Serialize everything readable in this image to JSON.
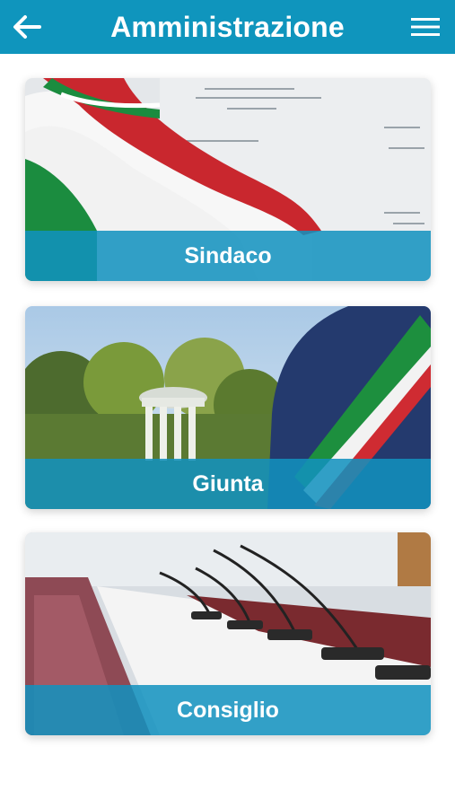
{
  "appbar": {
    "title": "Amministrazione",
    "back_icon": "arrow-left-icon",
    "menu_icon": "hamburger-menu-icon",
    "color": "#0f95bd"
  },
  "cards": [
    {
      "label": "Sindaco",
      "image": "italian-flag-document-image"
    },
    {
      "label": "Giunta",
      "image": "mayor-sash-park-image"
    },
    {
      "label": "Consiglio",
      "image": "council-chamber-microphones-image"
    }
  ],
  "accent_overlay": "#1192bf"
}
